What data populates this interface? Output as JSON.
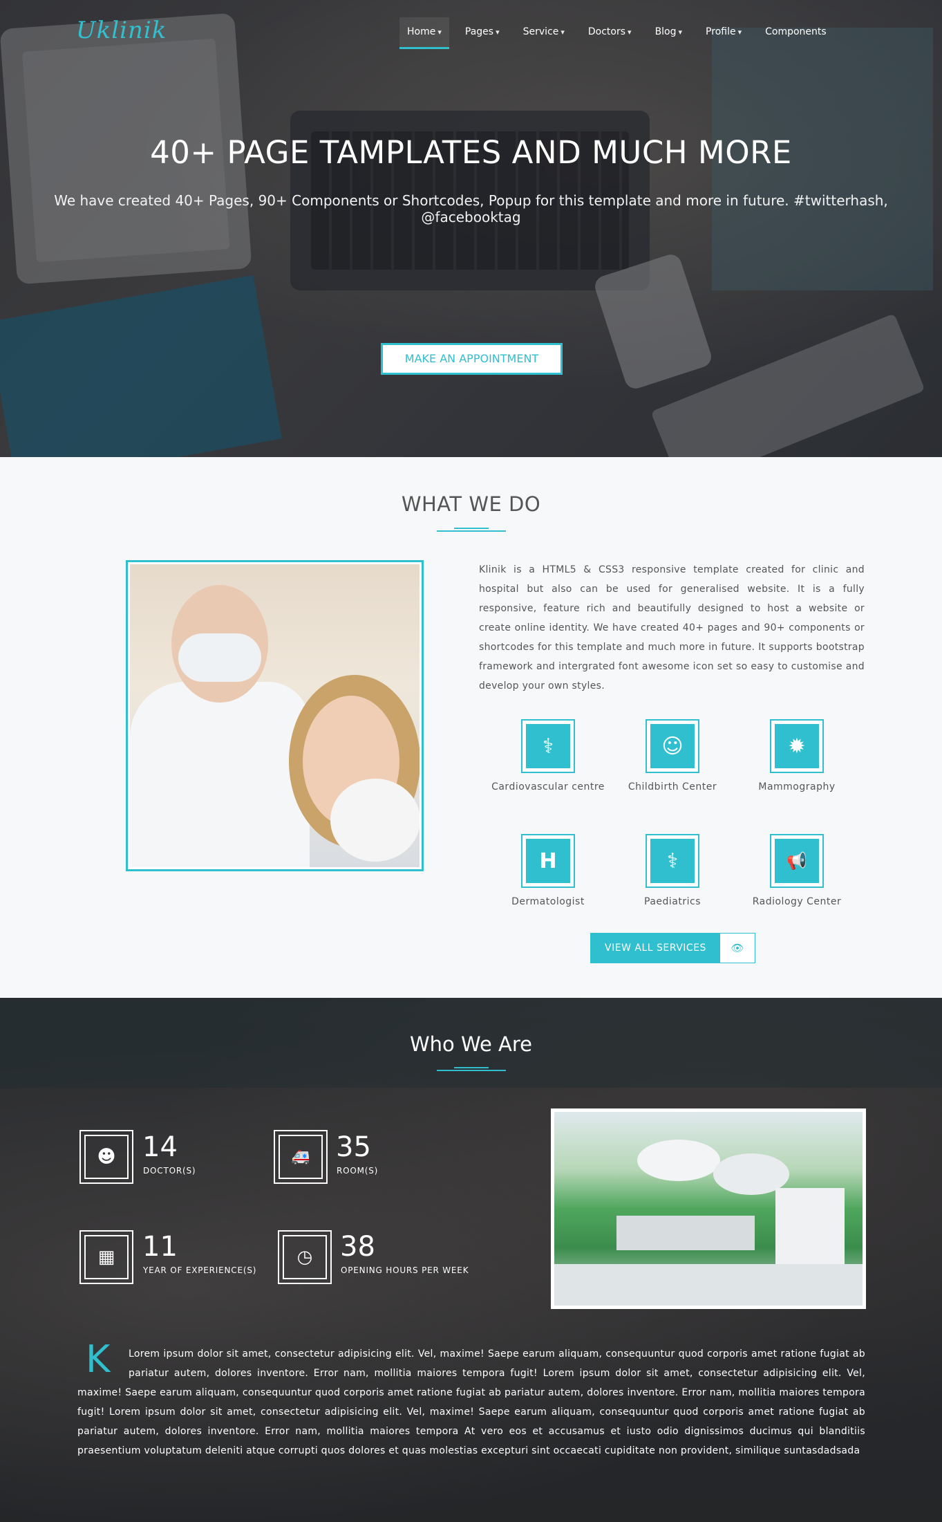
{
  "header": {
    "logo": "Uklinik",
    "nav": [
      {
        "label": "Home",
        "caret": "▾",
        "active": true
      },
      {
        "label": "Pages",
        "caret": "▾"
      },
      {
        "label": "Service",
        "caret": "▾"
      },
      {
        "label": "Doctors",
        "caret": "▾"
      },
      {
        "label": "Blog",
        "caret": "▾"
      },
      {
        "label": "Profile",
        "caret": "▾"
      },
      {
        "label": "Components"
      }
    ]
  },
  "hero": {
    "title": "40+ PAGE TAMPLATES AND MUCH MORE",
    "subtitle": "We have created 40+ Pages, 90+ Components or Shortcodes, Popup for this template and more in future. #twitterhash, @facebooktag",
    "button": "MAKE AN APPOINTMENT"
  },
  "what_we_do": {
    "title": "WHAT WE DO",
    "text": "Klinik is a HTML5 & CSS3 responsive template created for clinic and hospital but also can be used for generalised website. It is a fully responsive, feature rich and beautifully designed to host a website or create online identity. We have created 40+ pages and 90+ components or shortcodes for this template and much more in future. It supports bootstrap framework and intergrated font awesome icon set so easy to customise and develop your own styles.",
    "services": [
      {
        "label": "Cardiovascular centre",
        "icon": "stethoscope-icon",
        "glyph": "⚕"
      },
      {
        "label": "Childbirth Center",
        "icon": "child-icon",
        "glyph": "☺"
      },
      {
        "label": "Mammography",
        "icon": "certificate-icon",
        "glyph": "✹"
      },
      {
        "label": "Dermatologist",
        "icon": "hospital-h-icon",
        "glyph": "H"
      },
      {
        "label": "Paediatrics",
        "icon": "stethoscope-icon",
        "glyph": "⚕"
      },
      {
        "label": "Radiology Center",
        "icon": "bullhorn-icon",
        "glyph": "📢"
      }
    ],
    "view_all": "VIEW ALL SERVICES",
    "view_all_icon": "eye-icon",
    "view_all_glyph": "👁"
  },
  "who_we_are": {
    "title": "Who We Are",
    "stats": [
      {
        "number": "14",
        "label": "DOCTOR(S)",
        "icon": "user-md-icon",
        "glyph": "☻"
      },
      {
        "number": "35",
        "label": "ROOM(S)",
        "icon": "ambulance-icon",
        "glyph": "🚑"
      },
      {
        "number": "11",
        "label": "YEAR OF EXPERIENCE(S)",
        "icon": "calendar-icon",
        "glyph": "▦"
      },
      {
        "number": "38",
        "label": "OPENING HOURS PER WEEK",
        "icon": "clock-icon",
        "glyph": "◷"
      }
    ],
    "dropcap": "K",
    "text": "Lorem ipsum dolor sit amet, consectetur adipisicing elit. Vel, maxime! Saepe earum aliquam, consequuntur quod corporis amet ratione fugiat ab pariatur autem, dolores inventore. Error nam, mollitia maiores tempora fugit! Lorem ipsum dolor sit amet, consectetur adipisicing elit. Vel, maxime! Saepe earum aliquam, consequuntur quod corporis amet ratione fugiat ab pariatur autem, dolores inventore. Error nam, mollitia maiores tempora fugit! Lorem ipsum dolor sit amet, consectetur adipisicing elit. Vel, maxime! Saepe earum aliquam, consequuntur quod corporis amet ratione fugiat ab pariatur autem, dolores inventore. Error nam, mollitia maiores tempora At vero eos et accusamus et iusto odio dignissimos ducimus qui blanditiis praesentium voluptatum deleniti atque corrupti quos dolores et quas molestias excepturi sint occaecati cupiditate non provident, similique suntasdadsada"
  },
  "colors": {
    "accent": "#2fbfcf",
    "hero_overlay": "#14161c",
    "section_bg": "#f7f8f9"
  }
}
